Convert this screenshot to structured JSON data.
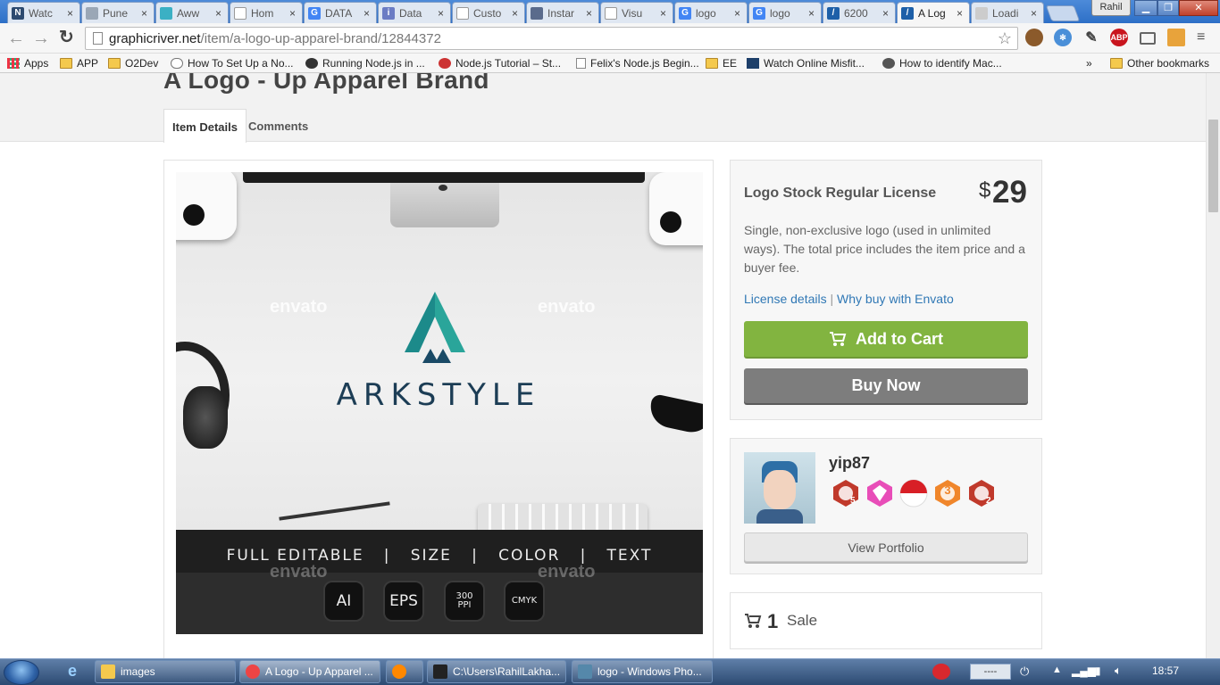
{
  "browser": {
    "tabs": [
      {
        "title": "Watc",
        "fav_color": "#2d4a6f",
        "fav_glyph": "N"
      },
      {
        "title": "Pune",
        "fav_color": "#9aa7b6",
        "fav_glyph": ""
      },
      {
        "title": "Aww",
        "fav_color": "#3bb0c4",
        "fav_glyph": ""
      },
      {
        "title": "Hom",
        "fav_color": "#ffffff",
        "fav_glyph": ""
      },
      {
        "title": "DATA",
        "fav_color": "#4285f4",
        "fav_glyph": "G"
      },
      {
        "title": "Data",
        "fav_color": "#6b7cc4",
        "fav_glyph": "i"
      },
      {
        "title": "Custo",
        "fav_color": "#ffffff",
        "fav_glyph": ""
      },
      {
        "title": "Instar",
        "fav_color": "#5a6b8c",
        "fav_glyph": ""
      },
      {
        "title": "Visu",
        "fav_color": "#ffffff",
        "fav_glyph": ""
      },
      {
        "title": "logo",
        "fav_color": "#4285f4",
        "fav_glyph": "G"
      },
      {
        "title": "logo",
        "fav_color": "#4285f4",
        "fav_glyph": "G"
      },
      {
        "title": "6200",
        "fav_color": "#1d5fa8",
        "fav_glyph": "/"
      },
      {
        "title": "A Log",
        "fav_color": "#1d5fa8",
        "fav_glyph": "/"
      },
      {
        "title": "Loadi",
        "fav_color": "#cccccc",
        "fav_glyph": ""
      }
    ],
    "close_glyph": "×",
    "user_name": "Rahil",
    "url_host": "graphicriver.net",
    "url_path": "/item/a-logo-up-apparel-brand/12844372",
    "nav": {
      "back": "←",
      "forward": "→",
      "reload": "↻",
      "star": "☆"
    },
    "bookmarks": [
      {
        "label": "Apps",
        "icon": "apps-grid-icon"
      },
      {
        "label": "APP",
        "icon": "folder-icon"
      },
      {
        "label": "O2Dev",
        "icon": "folder-icon"
      },
      {
        "label": "How To Set Up a No...",
        "icon": "cloud-icon"
      },
      {
        "label": "Running Node.js in ...",
        "icon": "node-icon"
      },
      {
        "label": "Node.js Tutorial – St...",
        "icon": "tutorial-icon"
      },
      {
        "label": "Felix's Node.js Begin...",
        "icon": "page-icon"
      },
      {
        "label": "EE",
        "icon": "folder-icon"
      },
      {
        "label": "Watch Online Misfit...",
        "icon": "watch-icon"
      },
      {
        "label": "How to identify Mac...",
        "icon": "apple-icon"
      }
    ],
    "bookmarks_overflow": "»",
    "other_bookmarks": "Other bookmarks",
    "abp_label": "ABP"
  },
  "page": {
    "item_title": "A Logo - Up Apparel Brand",
    "tabs": [
      "Item Details",
      "Comments"
    ],
    "preview": {
      "brand_name": "ARKSTYLE",
      "watermark": "envato",
      "features_line": "FULL EDITABLE   |   SIZE   |   COLOR   |   TEXT",
      "format_badges": [
        "AI",
        "EPS",
        "300\nPPI",
        "CMYK"
      ],
      "logo_colors": [
        "#1c8a8a",
        "#2aa59a",
        "#1a4a66"
      ]
    },
    "purchase": {
      "license_title": "Logo Stock Regular License",
      "currency": "$",
      "price": "29",
      "description": "Single, non-exclusive logo (used in unlimited ways). The total price includes the item price and a buyer fee.",
      "license_details_link": "License details",
      "separator": "|",
      "why_buy_link": "Why buy with Envato",
      "add_to_cart": "Add to Cart",
      "buy_now": "Buy Now"
    },
    "author": {
      "name": "yip87",
      "badges": [
        {
          "name": "paw-badge",
          "color": "#c0392b",
          "label": "5"
        },
        {
          "name": "diamond-badge",
          "color": "#e84db8",
          "label": ""
        },
        {
          "name": "indonesia-flag-badge",
          "color": "#d81f26",
          "label": ""
        },
        {
          "name": "author-level-badge",
          "color": "#f0862b",
          "label": "3"
        },
        {
          "name": "sc-badge",
          "color": "#c0392b",
          "label": "2"
        }
      ],
      "view_portfolio": "View Portfolio"
    },
    "sales": {
      "count": "1",
      "label": "Sale"
    }
  },
  "taskbar": {
    "items": [
      {
        "label": "images",
        "icon": "folder-icon"
      },
      {
        "label": "A Logo - Up Apparel ...",
        "icon": "chrome-icon"
      },
      {
        "label": "",
        "icon": "vlc-icon"
      },
      {
        "label": "C:\\Users\\RahilLakha...",
        "icon": "cmd-icon"
      },
      {
        "label": "logo - Windows Pho...",
        "icon": "photo-viewer-icon"
      }
    ],
    "tray_text": "----",
    "clock": "18:57"
  }
}
